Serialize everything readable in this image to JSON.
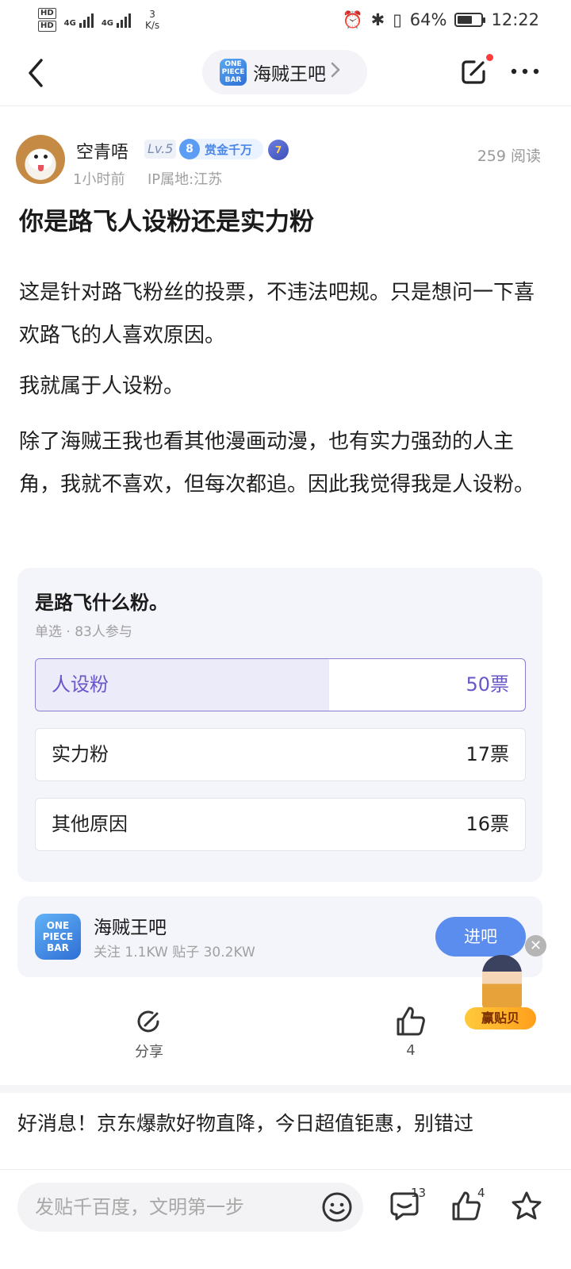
{
  "status_bar": {
    "hd1": "HD",
    "hd2": "HD",
    "net1": "4G",
    "net2": "4G",
    "speed_value": "3",
    "speed_unit": "K/s",
    "battery_percent": "64%",
    "battery_level": 0.64,
    "time": "12:22"
  },
  "header": {
    "bar_name": "海贼王吧",
    "bar_logo_text": "ONE PIECE BAR"
  },
  "post": {
    "author_name": "空青唔",
    "level": "Lv.5",
    "rank_number": "8",
    "rank_title": "赏金千万",
    "medal_number": "7",
    "read_count": "259 阅读",
    "time_ago": "1小时前",
    "ip_location": "IP属地:江苏",
    "title": "你是路飞人设粉还是实力粉",
    "paragraphs": [
      "这是针对路飞粉丝的投票，不违法吧规。只是想问一下喜欢路飞的人喜欢原因。",
      "我就属于人设粉。",
      "除了海贼王我也看其他漫画动漫，也有实力强劲的人主角，我就不喜欢，但每次都追。因此我觉得我是人设粉。"
    ]
  },
  "poll": {
    "question": "是路飞什么粉。",
    "meta": "单选 · 83人参与",
    "options": [
      {
        "label": "人设粉",
        "votes": "50票",
        "share": 0.6
      },
      {
        "label": "实力粉",
        "votes": "17票",
        "share": 0.2
      },
      {
        "label": "其他原因",
        "votes": "16票",
        "share": 0.19
      }
    ]
  },
  "forum_card": {
    "logo_text": "ONE PIECE BAR",
    "name": "海贼王吧",
    "stats": "关注 1.1KW  贴子 30.2KW",
    "join_label": "进吧"
  },
  "promo": {
    "label": "赢贴贝"
  },
  "actions": {
    "share_label": "分享",
    "like_count": "4"
  },
  "ad": {
    "text": "好消息！京东爆款好物直降，今日超值钜惠，别错过"
  },
  "bottom_bar": {
    "reply_placeholder": "发贴千百度，文明第一步",
    "comment_count": "13",
    "like_count": "4"
  },
  "colors": {
    "accent_purple": "#6a55c9",
    "join_blue": "#5b8def",
    "notify_red": "#ff3b3b"
  },
  "icons": [
    "back-arrow-icon",
    "chevron-right-icon",
    "edit-icon",
    "more-icon",
    "share-icon",
    "thumb-up-icon",
    "emoji-icon",
    "comment-icon",
    "star-icon",
    "close-icon"
  ]
}
